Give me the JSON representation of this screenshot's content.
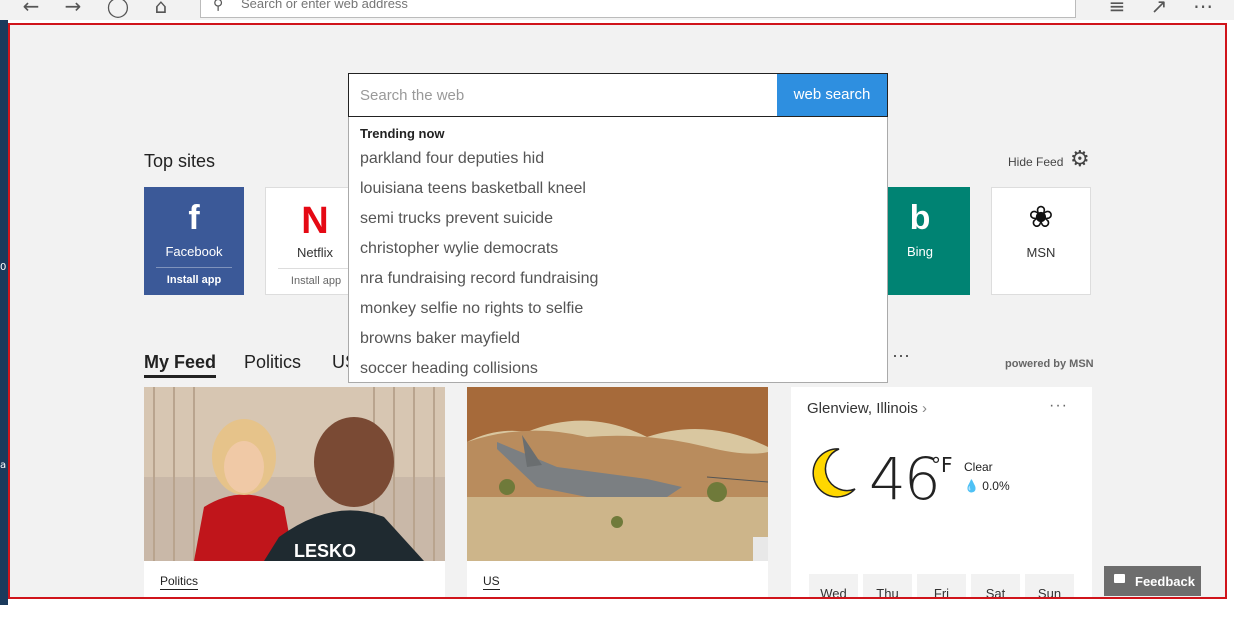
{
  "browser": {
    "address_placeholder": "Search or enter web address"
  },
  "icons": {
    "back": "back-arrow-icon",
    "forward": "forward-arrow-icon",
    "refresh": "refresh-icon",
    "home": "home-icon",
    "search": "search-icon",
    "favorites": "favorites-list-icon",
    "share": "share-icon",
    "more": "more-icon",
    "settings": "gear-icon",
    "weather": "moon-icon",
    "feedback": "chat-icon"
  },
  "search": {
    "placeholder": "Search the web",
    "button_label": "web search"
  },
  "trending": {
    "title": "Trending now",
    "items": [
      "parkland four deputies hid",
      "louisiana teens basketball kneel",
      "semi trucks prevent suicide",
      "christopher wylie democrats",
      "nra fundraising record fundraising",
      "monkey selfie no rights to selfie",
      "browns baker mayfield",
      "soccer heading collisions"
    ]
  },
  "top_sites": {
    "title": "Top sites",
    "hide_feed": "Hide Feed",
    "tiles": [
      {
        "name": "Facebook",
        "install": "Install app",
        "color": "#3b5998"
      },
      {
        "name": "Netflix",
        "install": "Install app",
        "color": "#e50914"
      },
      {
        "name": "Bing",
        "color": "#008373"
      },
      {
        "name": "MSN",
        "color": "#ffffff"
      }
    ]
  },
  "feed": {
    "tabs": [
      "My Feed",
      "Politics",
      "US"
    ],
    "more": "···",
    "powered_by": "powered by MSN",
    "cards": [
      {
        "category": "Politics"
      },
      {
        "category": "US"
      }
    ]
  },
  "weather": {
    "location": "Glenview, Illinois",
    "menu": "···",
    "temp": "46",
    "unit": "°F",
    "condition": "Clear",
    "precip": "0.0%",
    "days": [
      "Wed",
      "Thu",
      "Fri",
      "Sat",
      "Sun"
    ]
  },
  "feedback_label": "Feedback",
  "colors": {
    "accent": "#2e8fe0",
    "viewport_border": "#d0141b"
  }
}
